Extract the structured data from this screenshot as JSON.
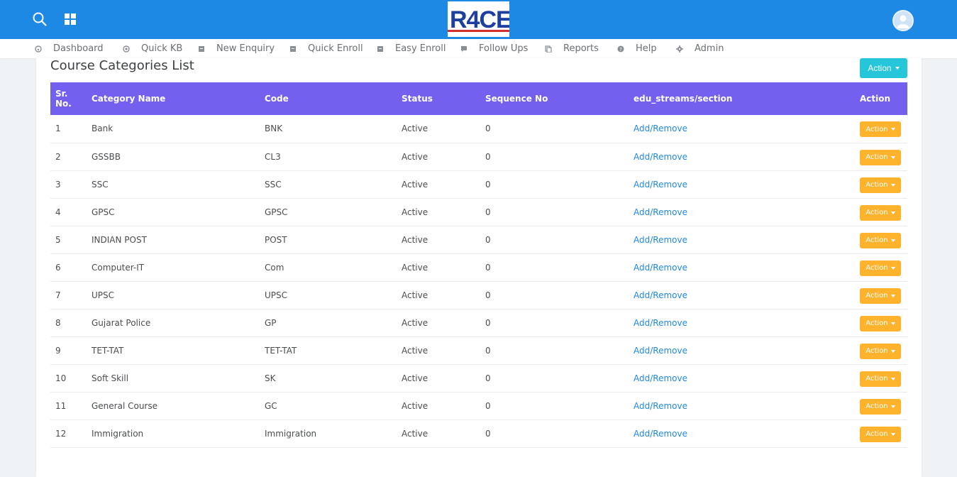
{
  "header": {
    "logo_text": "R4CE",
    "icons": [
      "search-icon",
      "apps-grid-icon",
      "user-avatar-icon"
    ]
  },
  "menu": {
    "items": [
      {
        "label": "Dashboard",
        "icon": "dashboard-icon"
      },
      {
        "label": "Quick KB",
        "icon": "target-icon"
      },
      {
        "label": "New Enquiry",
        "icon": "note-icon"
      },
      {
        "label": "Quick Enroll",
        "icon": "note-icon"
      },
      {
        "label": "Easy Enroll",
        "icon": "note-icon"
      },
      {
        "label": "Follow Ups",
        "icon": "chat-icon"
      },
      {
        "label": "Reports",
        "icon": "copy-icon"
      },
      {
        "label": "Help",
        "icon": "help-icon"
      },
      {
        "label": "Admin",
        "icon": "gear-icon"
      }
    ]
  },
  "page": {
    "title": "Course Categories List",
    "top_action_label": "Action"
  },
  "table": {
    "headers": [
      "Sr. No.",
      "Category Name",
      "Code",
      "Status",
      "Sequence No",
      "edu_streams/section",
      "Action"
    ],
    "rows": [
      {
        "sr": "1",
        "name": "Bank",
        "code": "BNK",
        "status": "Active",
        "seq": "0",
        "link": "Add/Remove",
        "action": "Action"
      },
      {
        "sr": "2",
        "name": "GSSBB",
        "code": "CL3",
        "status": "Active",
        "seq": "0",
        "link": "Add/Remove",
        "action": "Action"
      },
      {
        "sr": "3",
        "name": "SSC",
        "code": "SSC",
        "status": "Active",
        "seq": "0",
        "link": "Add/Remove",
        "action": "Action"
      },
      {
        "sr": "4",
        "name": "GPSC",
        "code": "GPSC",
        "status": "Active",
        "seq": "0",
        "link": "Add/Remove",
        "action": "Action"
      },
      {
        "sr": "5",
        "name": "INDIAN POST",
        "code": "POST",
        "status": "Active",
        "seq": "0",
        "link": "Add/Remove",
        "action": "Action"
      },
      {
        "sr": "6",
        "name": "Computer-IT",
        "code": "Com",
        "status": "Active",
        "seq": "0",
        "link": "Add/Remove",
        "action": "Action"
      },
      {
        "sr": "7",
        "name": "UPSC",
        "code": "UPSC",
        "status": "Active",
        "seq": "0",
        "link": "Add/Remove",
        "action": "Action"
      },
      {
        "sr": "8",
        "name": "Gujarat Police",
        "code": "GP",
        "status": "Active",
        "seq": "0",
        "link": "Add/Remove",
        "action": "Action"
      },
      {
        "sr": "9",
        "name": "TET-TAT",
        "code": "TET-TAT",
        "status": "Active",
        "seq": "0",
        "link": "Add/Remove",
        "action": "Action"
      },
      {
        "sr": "10",
        "name": "Soft Skill",
        "code": "SK",
        "status": "Active",
        "seq": "0",
        "link": "Add/Remove",
        "action": "Action"
      },
      {
        "sr": "11",
        "name": "General Course",
        "code": "GC",
        "status": "Active",
        "seq": "0",
        "link": "Add/Remove",
        "action": "Action"
      },
      {
        "sr": "12",
        "name": "Immigration",
        "code": "Immigration",
        "status": "Active",
        "seq": "0",
        "link": "Add/Remove",
        "action": "Action"
      }
    ]
  },
  "colors": {
    "topbar": "#1e88e5",
    "table_header": "#7460ee",
    "top_action": "#26c6da",
    "row_action": "#ffb22b",
    "link": "#1e88e5"
  }
}
